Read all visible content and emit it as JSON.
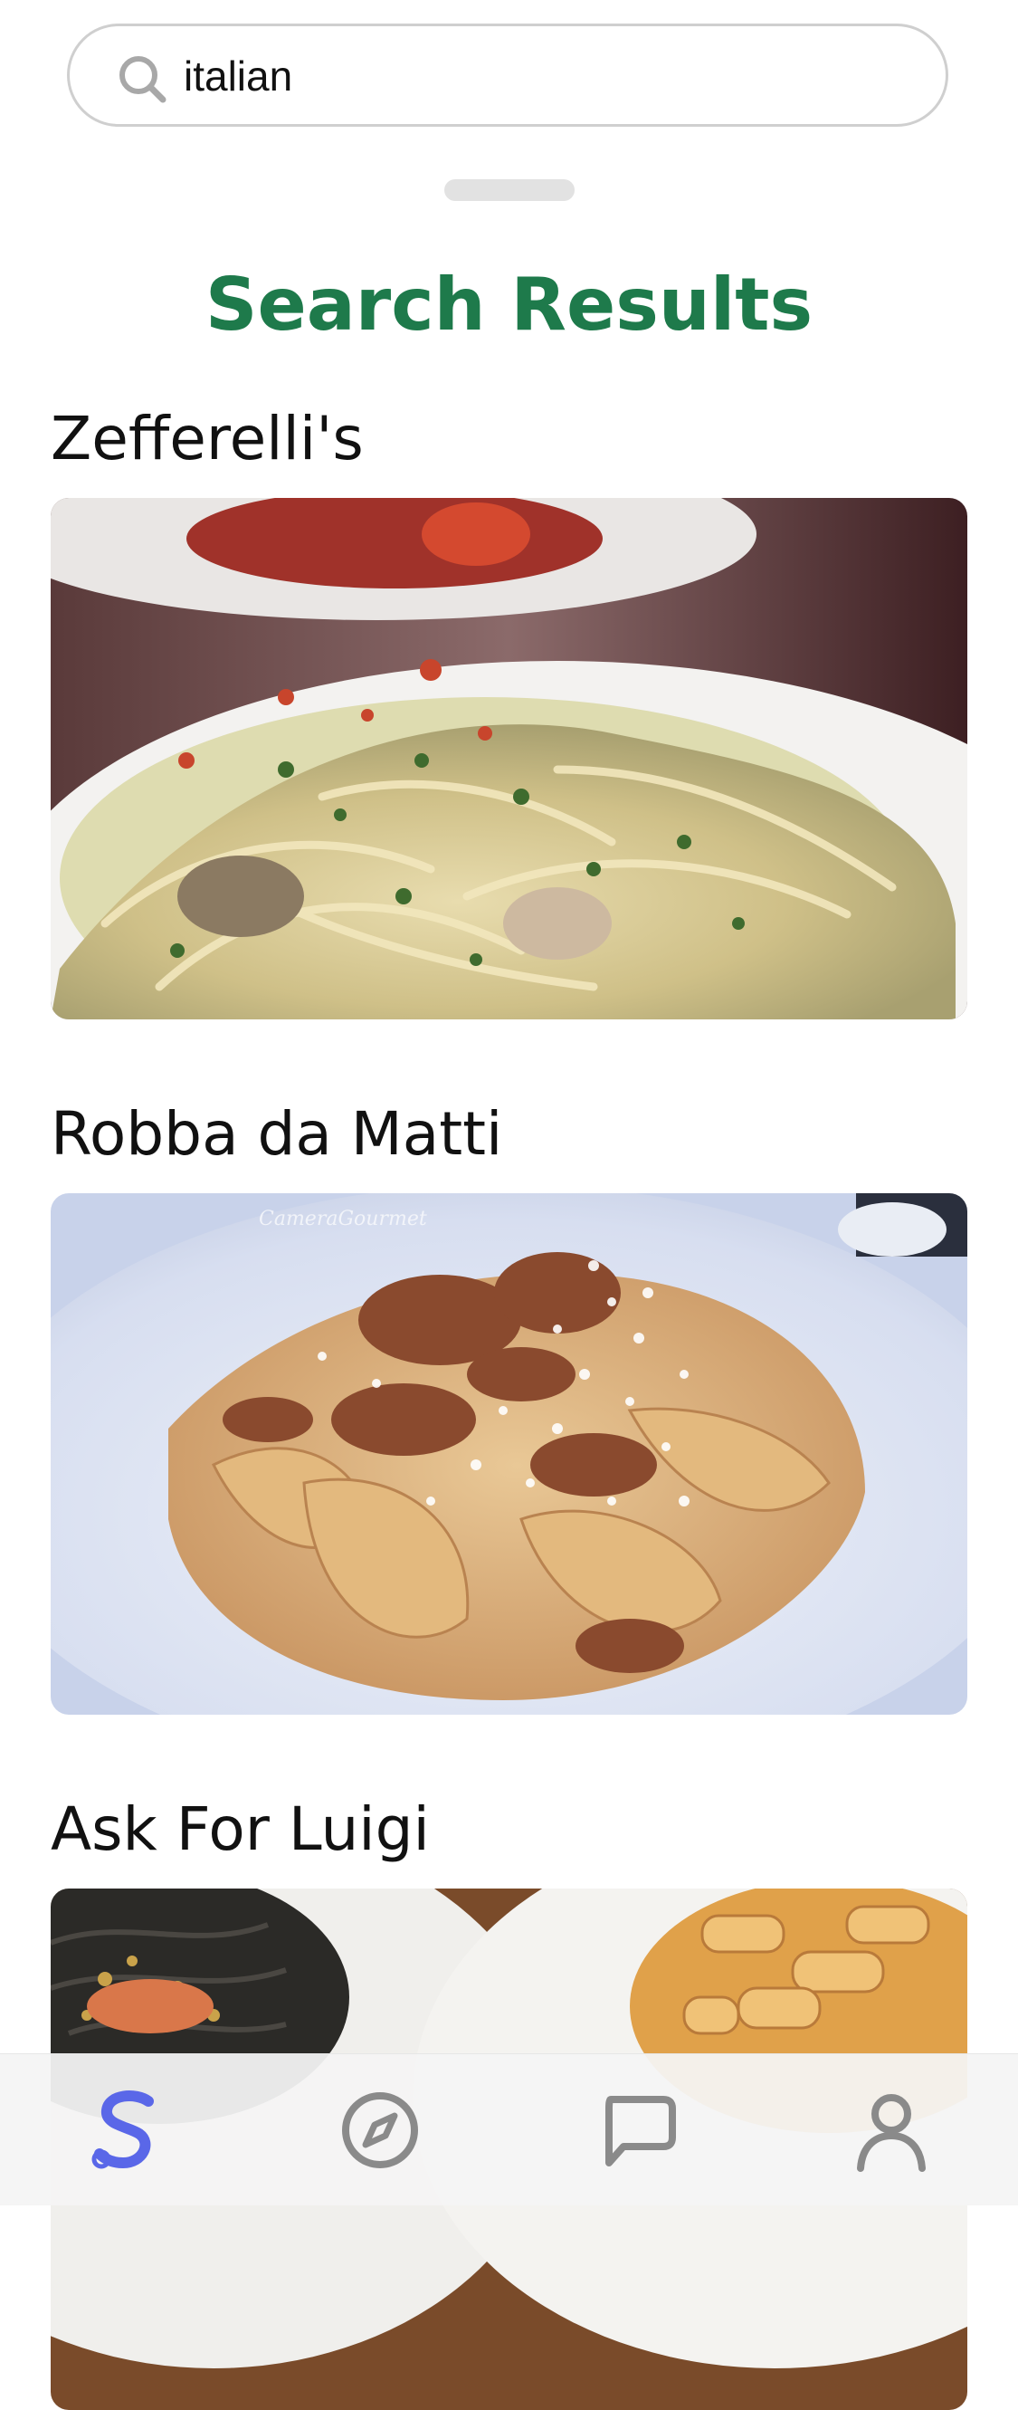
{
  "search": {
    "value": "italian",
    "placeholder": ""
  },
  "header": {
    "title": "Search Results"
  },
  "results": [
    {
      "name": "Zefferelli's",
      "image": "linguine-seafood-pasta-photo"
    },
    {
      "name": "Robba da Matti",
      "image": "pappardelle-bolognese-photo"
    },
    {
      "name": "Ask For Luigi",
      "image": "pasta-dishes-photo"
    }
  ],
  "nav": {
    "items": [
      {
        "icon": "app-logo-s-icon",
        "active": true
      },
      {
        "icon": "compass-icon",
        "active": false
      },
      {
        "icon": "chat-bubble-icon",
        "active": false
      },
      {
        "icon": "profile-icon",
        "active": false
      }
    ],
    "active_color": "#5a67e8",
    "inactive_color": "#8a8a8a"
  },
  "colors": {
    "title": "#1e7a4b",
    "search_border": "#cfcfcf"
  }
}
